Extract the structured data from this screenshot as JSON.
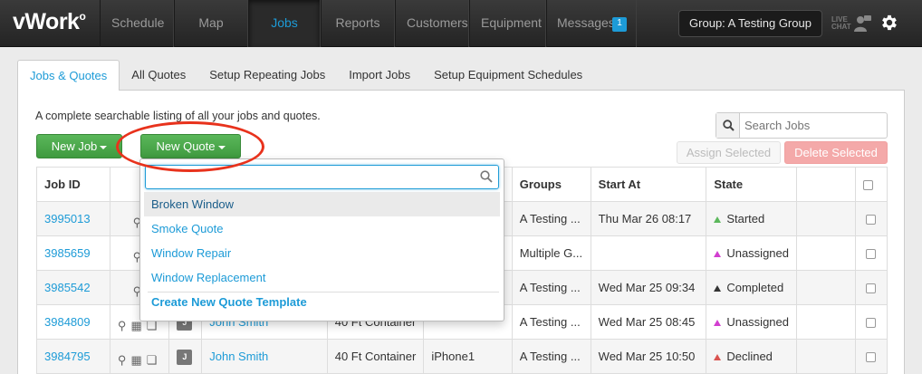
{
  "app": {
    "logo": "vWork",
    "nav": [
      "Schedule",
      "Map",
      "Jobs",
      "Reports",
      "Customers",
      "Equipment",
      "Messages"
    ],
    "messages_badge": "1",
    "group_label": "Group: A Testing Group",
    "livechat_label_1": "LIVE",
    "livechat_label_2": "CHAT"
  },
  "tabs": [
    "Jobs & Quotes",
    "All Quotes",
    "Setup Repeating Jobs",
    "Import Jobs",
    "Setup Equipment Schedules"
  ],
  "main": {
    "description": "A complete searchable listing of all your jobs and quotes.",
    "search_placeholder": "Search Jobs",
    "new_job_label": "New Job",
    "new_quote_label": "New Quote",
    "assign_selected_label": "Assign Selected",
    "delete_selected_label": "Delete Selected"
  },
  "table": {
    "headers": [
      "Job ID",
      "",
      "",
      "",
      "",
      "Groups",
      "Start At",
      "State",
      "",
      ""
    ],
    "rows": [
      {
        "id": "3995013",
        "badge": "",
        "customer": "",
        "template": "",
        "asset": "",
        "groups": "A Testing ...",
        "start": "Thu Mar 26 08:17",
        "state": "Started",
        "state_color": "#5cb85c"
      },
      {
        "id": "3985659",
        "badge": "",
        "customer": "",
        "template": "",
        "asset": "",
        "groups": "Multiple G...",
        "start": "",
        "state": "Unassigned",
        "state_color": "#d23fd0"
      },
      {
        "id": "3985542",
        "badge": "",
        "customer": "",
        "template": "",
        "asset": "",
        "groups": "A Testing ...",
        "start": "Wed Mar 25 09:34",
        "state": "Completed",
        "state_color": "#333333"
      },
      {
        "id": "3984809",
        "badge": "J",
        "customer": "John Smith",
        "template": "40 Ft Container",
        "asset": "",
        "groups": "A Testing ...",
        "start": "Wed Mar 25 08:45",
        "state": "Unassigned",
        "state_color": "#d23fd0"
      },
      {
        "id": "3984795",
        "badge": "J",
        "customer": "John Smith",
        "template": "40 Ft Container",
        "asset": "iPhone1",
        "groups": "A Testing ...",
        "start": "Wed Mar 25 10:50",
        "state": "Declined",
        "state_color": "#d9534f"
      }
    ]
  },
  "dropdown": {
    "items": [
      "Broken Window",
      "Smoke Quote",
      "Window Repair",
      "Window Replacement"
    ],
    "create_label": "Create New Quote Template"
  },
  "colors": {
    "accent": "#1d9bd7",
    "green": "#4cae4c",
    "annotation": "#e8321c"
  }
}
